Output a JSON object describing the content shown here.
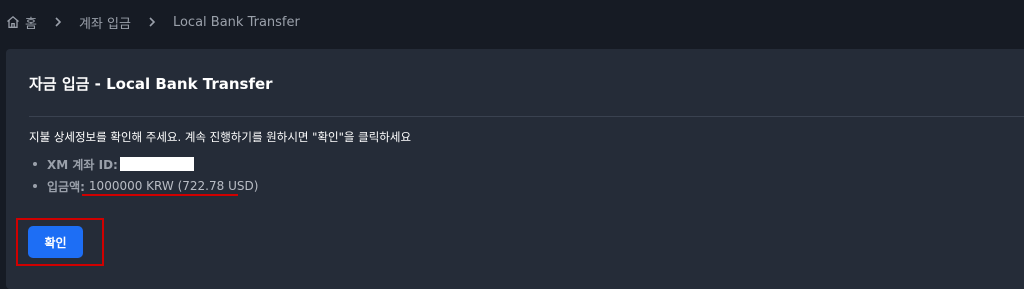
{
  "breadcrumb": {
    "items": [
      "홈",
      "계좌 입금",
      "Local Bank Transfer"
    ]
  },
  "card": {
    "title": "자금 입금 - Local Bank Transfer",
    "instructions": "지불 상세정보를 확인해 주세요. 계속 진행하기를 원하시면 \"확인\"을 클릭하세요",
    "details": {
      "account_label": "XM 계좌 ID:",
      "amount_label": "입금액:",
      "amount_value": "1000000 KRW (722.78 USD)"
    },
    "confirm_label": "확인"
  },
  "colors": {
    "background": "#161b24",
    "card": "#252c38",
    "accent_button": "#1d6ef5",
    "annotation_red": "#d00000"
  },
  "icons": {
    "home": "home-icon",
    "separator": "chevron-right-icon"
  }
}
